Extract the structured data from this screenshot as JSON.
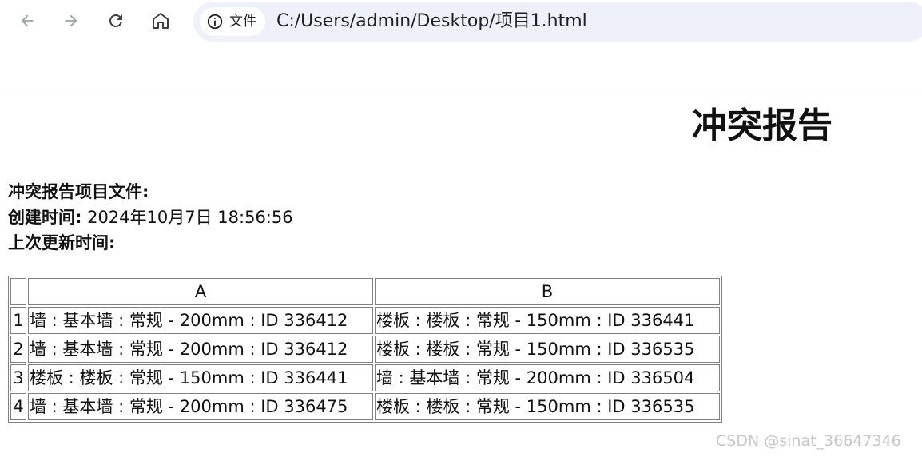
{
  "browser": {
    "back_icon": "arrow-left-icon",
    "forward_icon": "arrow-right-icon",
    "reload_icon": "reload-icon",
    "home_icon": "home-icon",
    "site_info_icon": "info-icon",
    "site_chip_label": "文件",
    "url": "C:/Users/admin/Desktop/项目1.html"
  },
  "report": {
    "title": "冲突报告",
    "project_file_label": "冲突报告项目文件:",
    "project_file_value": "",
    "created_label": "创建时间:",
    "created_value": " 2024年10月7日 18:56:56",
    "updated_label": "上次更新时间:",
    "updated_value": ""
  },
  "table": {
    "headers": [
      "",
      "A",
      "B"
    ],
    "rows": [
      {
        "index": "1",
        "a": "墙 : 基本墙 : 常规 - 200mm : ID 336412",
        "b": "楼板 : 楼板 : 常规 - 150mm : ID 336441"
      },
      {
        "index": "2",
        "a": "墙 : 基本墙 : 常规 - 200mm : ID 336412",
        "b": "楼板 : 楼板 : 常规 - 150mm : ID 336535"
      },
      {
        "index": "3",
        "a": "楼板 : 楼板 : 常规 - 150mm : ID 336441",
        "b": "墙 : 基本墙 : 常规 - 200mm : ID 336504"
      },
      {
        "index": "4",
        "a": "墙 : 基本墙 : 常规 - 200mm : ID 336475",
        "b": "楼板 : 楼板 : 常规 - 150mm : ID 336535"
      }
    ]
  },
  "watermark": "CSDN @sinat_36647346",
  "colors": {
    "omnibox_bg": "#eef1fa",
    "icon_gray": "#5f6368",
    "icon_dim": "#9aa0a6",
    "table_border": "#808080"
  }
}
